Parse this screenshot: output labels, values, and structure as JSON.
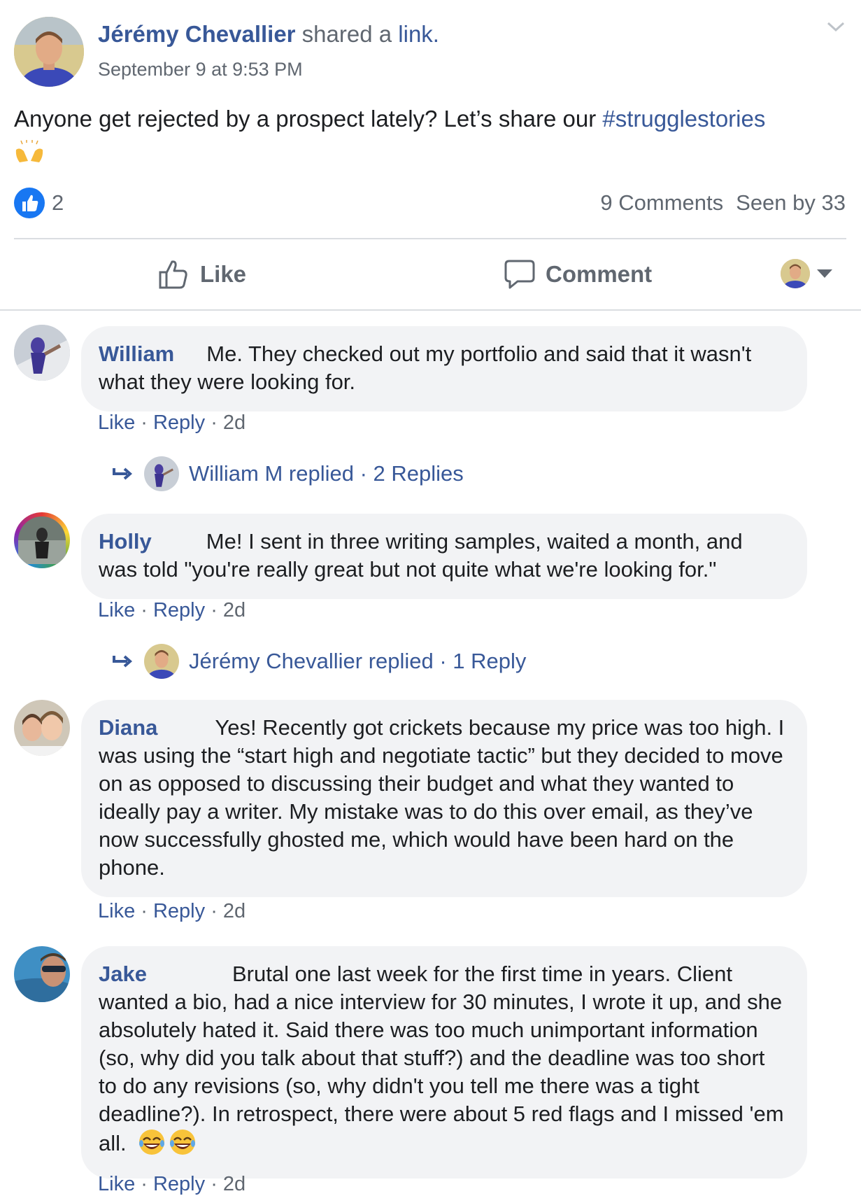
{
  "post": {
    "author": "Jérémy Chevallier",
    "shared_text": " shared a ",
    "link_text": "link.",
    "time": "September 9 at 9:53 PM",
    "text": "Anyone get rejected by a prospect lately? Let’s share our ",
    "hashtag": "#strugglestories",
    "emoji": "raising-hands-emoji",
    "reaction_count": "2",
    "comments_count": "9 Comments",
    "seen_by": "Seen by 33"
  },
  "actions": {
    "like": "Like",
    "comment": "Comment"
  },
  "comments": [
    {
      "name": "William",
      "text": "Me. They checked out my portfolio and said that it wasn't what they were looking for.",
      "like": "Like",
      "reply": "Reply",
      "age": "2d",
      "replies_text": "William M replied · 2 Replies"
    },
    {
      "name": "Holly",
      "text": "Me! I sent in three writing samples, waited a month, and was told \"you're really great but not quite what we're looking for.\"",
      "like": "Like",
      "reply": "Reply",
      "age": "2d",
      "replies_text": "Jérémy Chevallier replied · 1 Reply"
    },
    {
      "name": "Diana",
      "text": "Yes! Recently got crickets because my price was too high. I was using the “start high and negotiate tactic” but they decided to move on as opposed to discussing their budget and what they wanted to ideally pay a writer. My mistake was to do this over email, as they’ve now successfully ghosted me, which would have been hard on the phone.",
      "like": "Like",
      "reply": "Reply",
      "age": "2d"
    },
    {
      "name": "Jake",
      "text": "Brutal one last week for the first time in years. Client wanted a bio, had a nice interview for 30 minutes, I wrote it up, and she absolutely hated it. Said there was too much unimportant information (so, why did you talk about that stuff?) and the deadline was too short to do any revisions (so, why didn't you tell me there was a tight deadline?). In retrospect, there were about 5 red flags and I missed 'em all.",
      "emoji": "laughing-emoji",
      "like": "Like",
      "reply": "Reply",
      "age": "2d"
    }
  ],
  "colors": {
    "link": "#385898",
    "muted": "#606770",
    "bubble": "#f2f3f5",
    "like_blue": "#1877f2"
  }
}
